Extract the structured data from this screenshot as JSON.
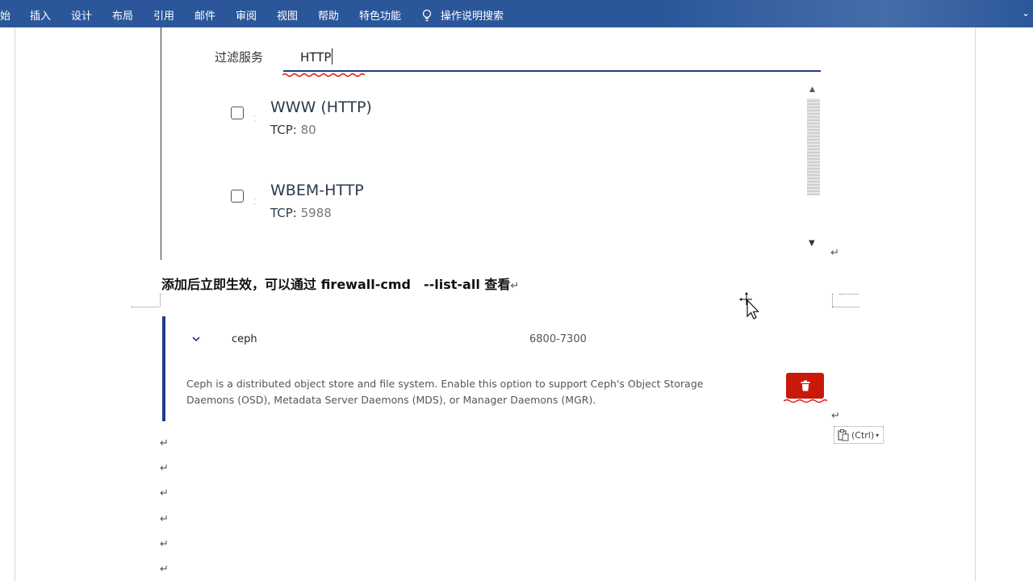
{
  "ribbon": {
    "tabs": [
      "始",
      "插入",
      "设计",
      "布局",
      "引用",
      "邮件",
      "审阅",
      "视图",
      "帮助",
      "特色功能"
    ],
    "tell_me": "操作说明搜索"
  },
  "firewall_dialog": {
    "filter_label": "过滤服务",
    "filter_value": "HTTP",
    "services": [
      {
        "name": "WWW (HTTP)",
        "port_label": "TCP:",
        "port_value": "80"
      },
      {
        "name": "WBEM-HTTP",
        "port_label": "TCP:",
        "port_value": "5988"
      }
    ]
  },
  "doc": {
    "line1": "添加后立即生效，可以通过 firewall-cmd　--list-all 查看"
  },
  "ceph_panel": {
    "name": "ceph",
    "ports": "6800-7300",
    "description": "Ceph is a distributed object store and file system. Enable this option to support Ceph's Object Storage Daemons (OSD), Metadata Server Daemons (MDS), or Manager Daemons (MGR)."
  },
  "paste_options": {
    "label": "(Ctrl)"
  },
  "colors": {
    "ribbon": "#2b579a",
    "accent_blue": "#1f3c88",
    "delete_red": "#c9190b"
  }
}
